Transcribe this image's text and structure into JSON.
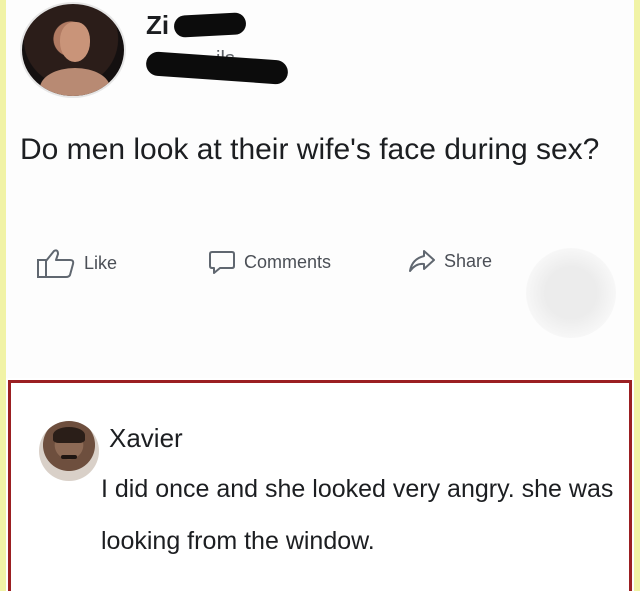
{
  "post": {
    "author_visible": "Zi",
    "subtitle_visible": "ils",
    "text": "Do men look at their wife's face during sex?",
    "actions": {
      "like_label": "Like",
      "comments_label": "Comments",
      "share_label": "Share"
    }
  },
  "comment": {
    "author": "Xavier",
    "text": "I did once and she looked very angry. she was looking from the window."
  },
  "icons": [
    "like-icon",
    "comment-icon",
    "share-icon"
  ],
  "colors": {
    "highlight_border": "#9b1f22",
    "action_text": "#4b4f56",
    "side_edge": "#f1f3a6"
  }
}
